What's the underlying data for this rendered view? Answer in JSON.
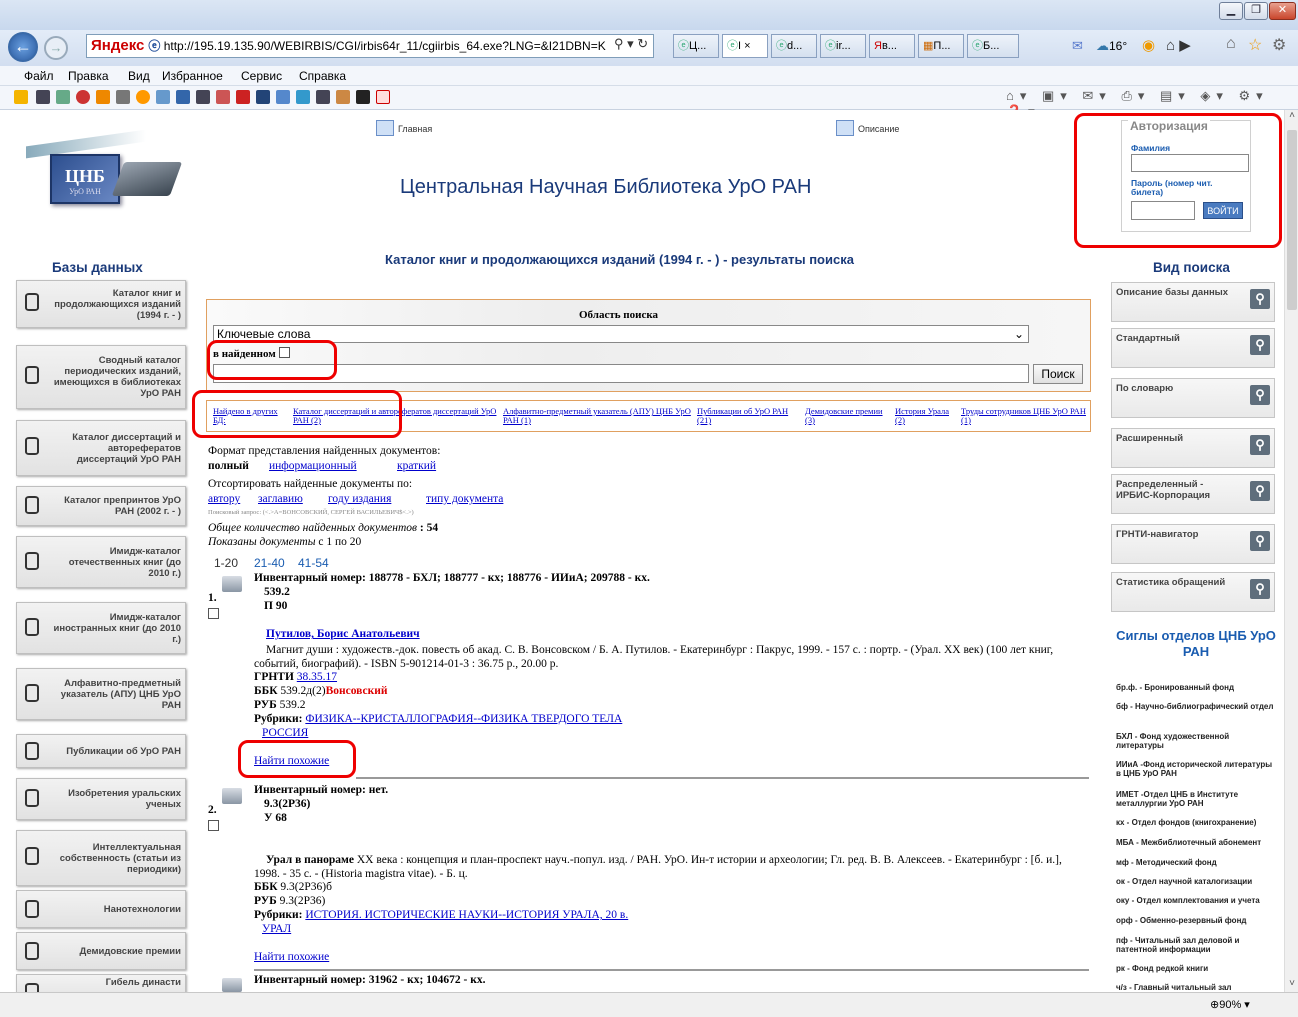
{
  "browser": {
    "brand": "Яндекс",
    "address": "http://195.19.135.90/WEBIRBIS/CGI/irbis64r_11/cgiirbis_64.exe?LNG=&I21DBN=K",
    "tabs": [
      "Ц...",
      "I ×",
      "d...",
      "ir...",
      "в...",
      "П...",
      "Б..."
    ],
    "weather": "16°",
    "menu": [
      "Файл",
      "Правка",
      "Вид",
      "Избранное",
      "Сервис",
      "Справка"
    ],
    "zoom": "90%"
  },
  "header": {
    "nav_home": "Главная",
    "nav_desc": "Описание",
    "logo_text": "ЦНБ",
    "logo_sub": "УрО РАН",
    "site_title": "Центральная Научная Библиотека УрО РАН",
    "results_title": "Каталог книг и продолжающихся изданий (1994 г. - ) - результаты поиска"
  },
  "auth": {
    "legend": "Авторизация",
    "surname_label": "Фамилия",
    "password_label": "Пароль (номер чит. билета)",
    "login_button": "ВОЙТИ"
  },
  "left": {
    "heading": "Базы данных",
    "items": [
      "Каталог книг и продолжающихся изданий (1994 г. - )",
      "Сводный каталог периодических изданий, имеющихся в библиотеках УрО РАН",
      "Каталог диссертаций и авторефератов диссертаций УрО РАН",
      "Каталог препринтов УрО РАН (2002 г. - )",
      "Имидж-каталог отечественных книг (до 2010 г.)",
      "Имидж-каталог иностранных книг (до 2010 г.)",
      "Алфавитно-предметный указатель (АПУ) ЦНБ УрО РАН",
      "Публикации об УрО РАН",
      "Изобретения уральских ученых",
      "Интеллектуальная собственность (статьи из периодики)",
      "Нанотехнологии",
      "Демидовские премии",
      "Гибель династи"
    ]
  },
  "right": {
    "heading": "Вид поиска",
    "items": [
      "Описание базы данных",
      "Стандартный",
      "По словарю",
      "Расширенный",
      "Распределенный - ИРБИС-Корпорация",
      "ГРНТИ-навигатор",
      "Статистика обращений"
    ],
    "sigla_heading": "Сиглы отделов ЦНБ УрО РАН",
    "sigla": [
      "бр.ф. - Бронированный фонд",
      "бф - Научно-библиографический отдел",
      "БХЛ - Фонд художественной литературы",
      "ИИиА -Фонд исторической литературы в ЦНБ УрО РАН",
      "ИМЕТ -Отдел ЦНБ в Институте металлургии УрО РАН",
      "кх - Отдел фондов (книгохранение)",
      "МБА - Межбиблиотечный абонемент",
      "мф - Методический фонд",
      "ок - Отдел научной каталогизации",
      "оку - Отдел комплектования и учета",
      "орф - Обменно-резервный фонд",
      "пф - Читальный зал деловой и патентной информации",
      "рк - Фонд редкой книги",
      "ч/з - Главный читальный зал"
    ]
  },
  "search": {
    "area_label": "Область поиска",
    "select_value": "Ключевые слова",
    "within_label": "в найденном",
    "button": "Поиск"
  },
  "other_db": {
    "label": "Найдено в других БД:",
    "links": [
      "Каталог диссертаций и авторефератов диссертаций УрО РАН (2)",
      "Алфавитно-предметный указатель (АПУ) ЦНБ УрО РАН (1)",
      "Публикации об УрО РАН (21)",
      "Демидовские премии (3)",
      "История Урала (2)",
      "Труды сотрудников ЦНБ УрО РАН (1)"
    ]
  },
  "format": {
    "label": "Формат представления найденных документов:",
    "current": "полный",
    "options": [
      "информационный",
      "краткий"
    ],
    "sort_label": "Отсортировать найденные документы по:",
    "sort_options": [
      "автору",
      "заглавию",
      "году издания",
      "типу документа"
    ],
    "query": "Поисковый запрос: (<.>A=ВОНСОВСКИЙ, СЕРГЕЙ ВАСИЛЬЕВИЧ$<.>)",
    "total_label": "Общее количество найденных документов",
    "total": ": 54",
    "shown_label": "Показаны документы",
    "shown": "с 1 по 20",
    "pages": [
      "1-20",
      "21-40",
      "41-54"
    ]
  },
  "records": [
    {
      "num": "1.",
      "inventory": "Инвентарный номер: 188778 - БХЛ; 188777 - кх; 188776 - ИИиА; 209788 - кх.",
      "class1": "539.2",
      "class2": "П 90",
      "author": "Путилов, Борис Анатольевич",
      "body": "Магнит души : художеств.-док. повесть об акад. С. В. Вонсовском / Б. А. Путилов. - Екатеринбург : Пакрус, 1999. - 157 с. : портр. - (Урал. XX век) (100 лет книг, событий, биографий). - ISBN 5-901214-01-3 : 36.75 р., 20.00 р.",
      "grnti_label": "ГРНТИ",
      "grnti": "38.35.17",
      "bbk_label": "ББК",
      "bbk": "539.2д(2)",
      "bbk_red": "Вонсовский",
      "rub_label": "РУБ",
      "rub": "539.2",
      "rubrics_label": "Рубрики:",
      "rubrics": "ФИЗИКА--КРИСТАЛЛОГРАФИЯ--ФИЗИКА ТВЕРДОГО ТЕЛА",
      "rubrics2": "РОССИЯ",
      "similar": "Найти похожие"
    },
    {
      "num": "2.",
      "inventory": "Инвентарный номер: нет.",
      "class1": "9.3(2Р36)",
      "class2": "У 68",
      "title": "Урал в панораме",
      "body": "XX века : концепция и план-проспект науч.-попул. изд. / РАН. УрО. Ин-т истории и археологии; Гл. ред. В. В. Алексеев. - Екатеринбург : [б. и.], 1998. - 35 с. - (Historia magistra vitae). - Б. ц.",
      "bbk_label": "ББК",
      "bbk": "9.3(2Р36)б",
      "rub_label": "РУБ",
      "rub": "9.3(2Р36)",
      "rubrics_label": "Рубрики:",
      "rubrics": "ИСТОРИЯ. ИСТОРИЧЕСКИЕ НАУКИ--ИСТОРИЯ УРАЛА, 20 в.",
      "rubrics2": "УРАЛ",
      "similar": "Найти похожие"
    },
    {
      "inventory": "Инвентарный номер: 31962 - кх; 104672 - кх."
    }
  ]
}
